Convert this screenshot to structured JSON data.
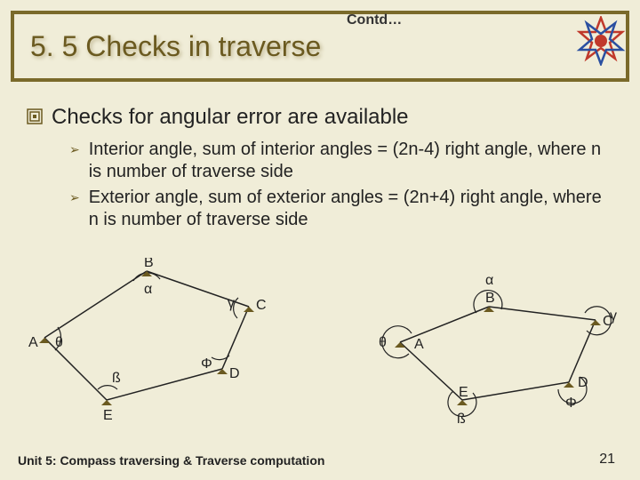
{
  "header": {
    "title": "5. 5 Checks in traverse",
    "contd": "Contd…"
  },
  "main_bullet": "Checks for angular error are available",
  "sub_bullets": [
    "Interior angle, sum of interior angles = (2n-4) right angle, where n is number of traverse side",
    "Exterior angle, sum of exterior angles = (2n+4) right angle, where n is number of traverse side"
  ],
  "diagram_left": {
    "vertices": [
      "A",
      "B",
      "C",
      "D",
      "E"
    ],
    "angles": [
      "θ",
      "α",
      "γ",
      "Φ",
      "ß"
    ]
  },
  "diagram_right": {
    "vertices": [
      "A",
      "B",
      "C",
      "D",
      "E"
    ],
    "angles": [
      "θ",
      "α",
      "γ",
      "Φ",
      "ß"
    ]
  },
  "footer": "Unit 5: Compass traversing & Traverse computation",
  "page_number": "21"
}
